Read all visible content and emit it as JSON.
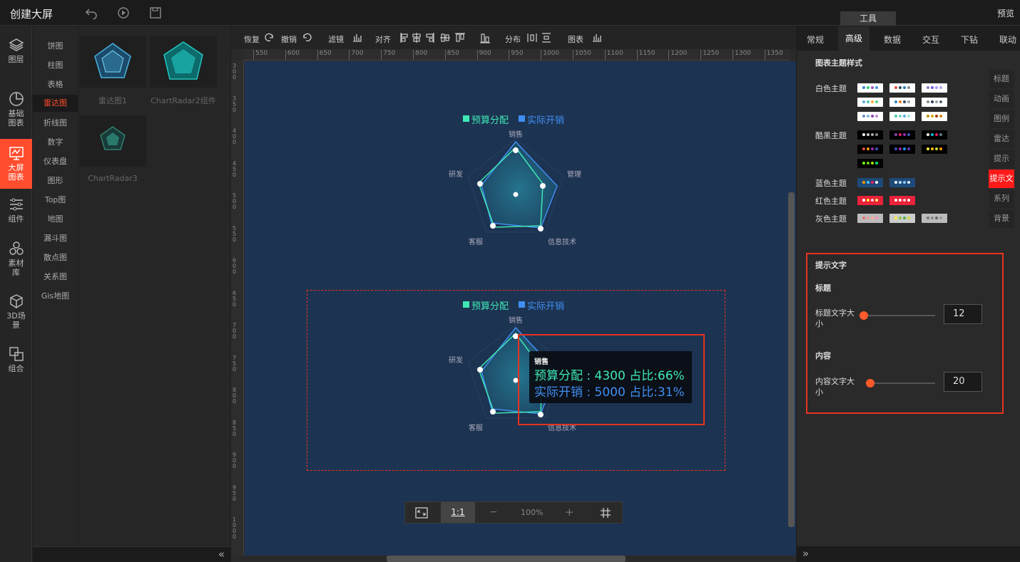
{
  "topbar": {
    "title": "创建大屏",
    "tool_tab": "工具",
    "preview": "预览"
  },
  "leftnav": [
    {
      "label": "图层",
      "icon": "layers-icon"
    },
    {
      "label": "基础图表",
      "icon": "clock-chart-icon"
    },
    {
      "label": "大屏图表",
      "icon": "screen-chart-icon"
    },
    {
      "label": "组件",
      "icon": "sliders-icon"
    },
    {
      "label": "素材库",
      "icon": "hexagons-icon"
    },
    {
      "label": "3D场景",
      "icon": "cube-icon"
    },
    {
      "label": "组合",
      "icon": "group-icon"
    }
  ],
  "categories": [
    "饼图",
    "柱图",
    "表格",
    "雷达图",
    "折线图",
    "数字",
    "仪表盘",
    "图形",
    "Top图",
    "地图",
    "漏斗图",
    "散点图",
    "关系图",
    "Gis地图"
  ],
  "thumbs": [
    "雷达图1",
    "ChartRadar2组件",
    "ChartRadar3"
  ],
  "toolbar": {
    "redo": "恢复",
    "undo": "撤销",
    "filter": "滤镜",
    "align": "对齐",
    "distribute": "分布",
    "chart": "图表"
  },
  "ruler_h": [
    "550",
    "600",
    "650",
    "700",
    "750",
    "800",
    "850",
    "900",
    "950",
    "1000",
    "1050",
    "1100",
    "1150",
    "1200",
    "1250",
    "1300",
    "1350"
  ],
  "ruler_v": [
    "300",
    "350",
    "400",
    "450",
    "500",
    "550",
    "600",
    "650",
    "700",
    "750",
    "800",
    "850",
    "900",
    "950",
    "1000"
  ],
  "radar": {
    "legend": [
      "预算分配",
      "实际开销"
    ],
    "indicators": [
      "销售",
      "管理",
      "信息技术",
      "客服",
      "研发"
    ],
    "colors": {
      "budget": "#3ee8b5",
      "actual": "#3f8ff2"
    }
  },
  "tooltip": {
    "title": "销售",
    "line1": "预算分配 : 4300 占比:66%",
    "line2": "实际开销 : 5000 占比:31%"
  },
  "zoom": {
    "ratio": "1:1",
    "minus": "−",
    "value": "100%",
    "plus": "+"
  },
  "right_tabs": [
    "常规",
    "高级",
    "数据",
    "交互",
    "下钻",
    "联动"
  ],
  "side_tabs": [
    "标题",
    "动画",
    "图例",
    "雷达",
    "提示",
    "提示文",
    "系列",
    "背景"
  ],
  "theme_section": {
    "title": "图表主题样式",
    "groups": [
      "白色主题",
      "酷黑主题",
      "蓝色主题",
      "红色主题",
      "灰色主题"
    ]
  },
  "tip_text": {
    "title": "提示文字",
    "sub_title": "标题",
    "title_size_label": "标题文字大小",
    "title_size_value": "12",
    "sub_content": "内容",
    "content_size_label": "内容文字大小",
    "content_size_value": "20"
  },
  "colors": {
    "accent": "#ff4d2d",
    "stage": "#1d3352"
  }
}
